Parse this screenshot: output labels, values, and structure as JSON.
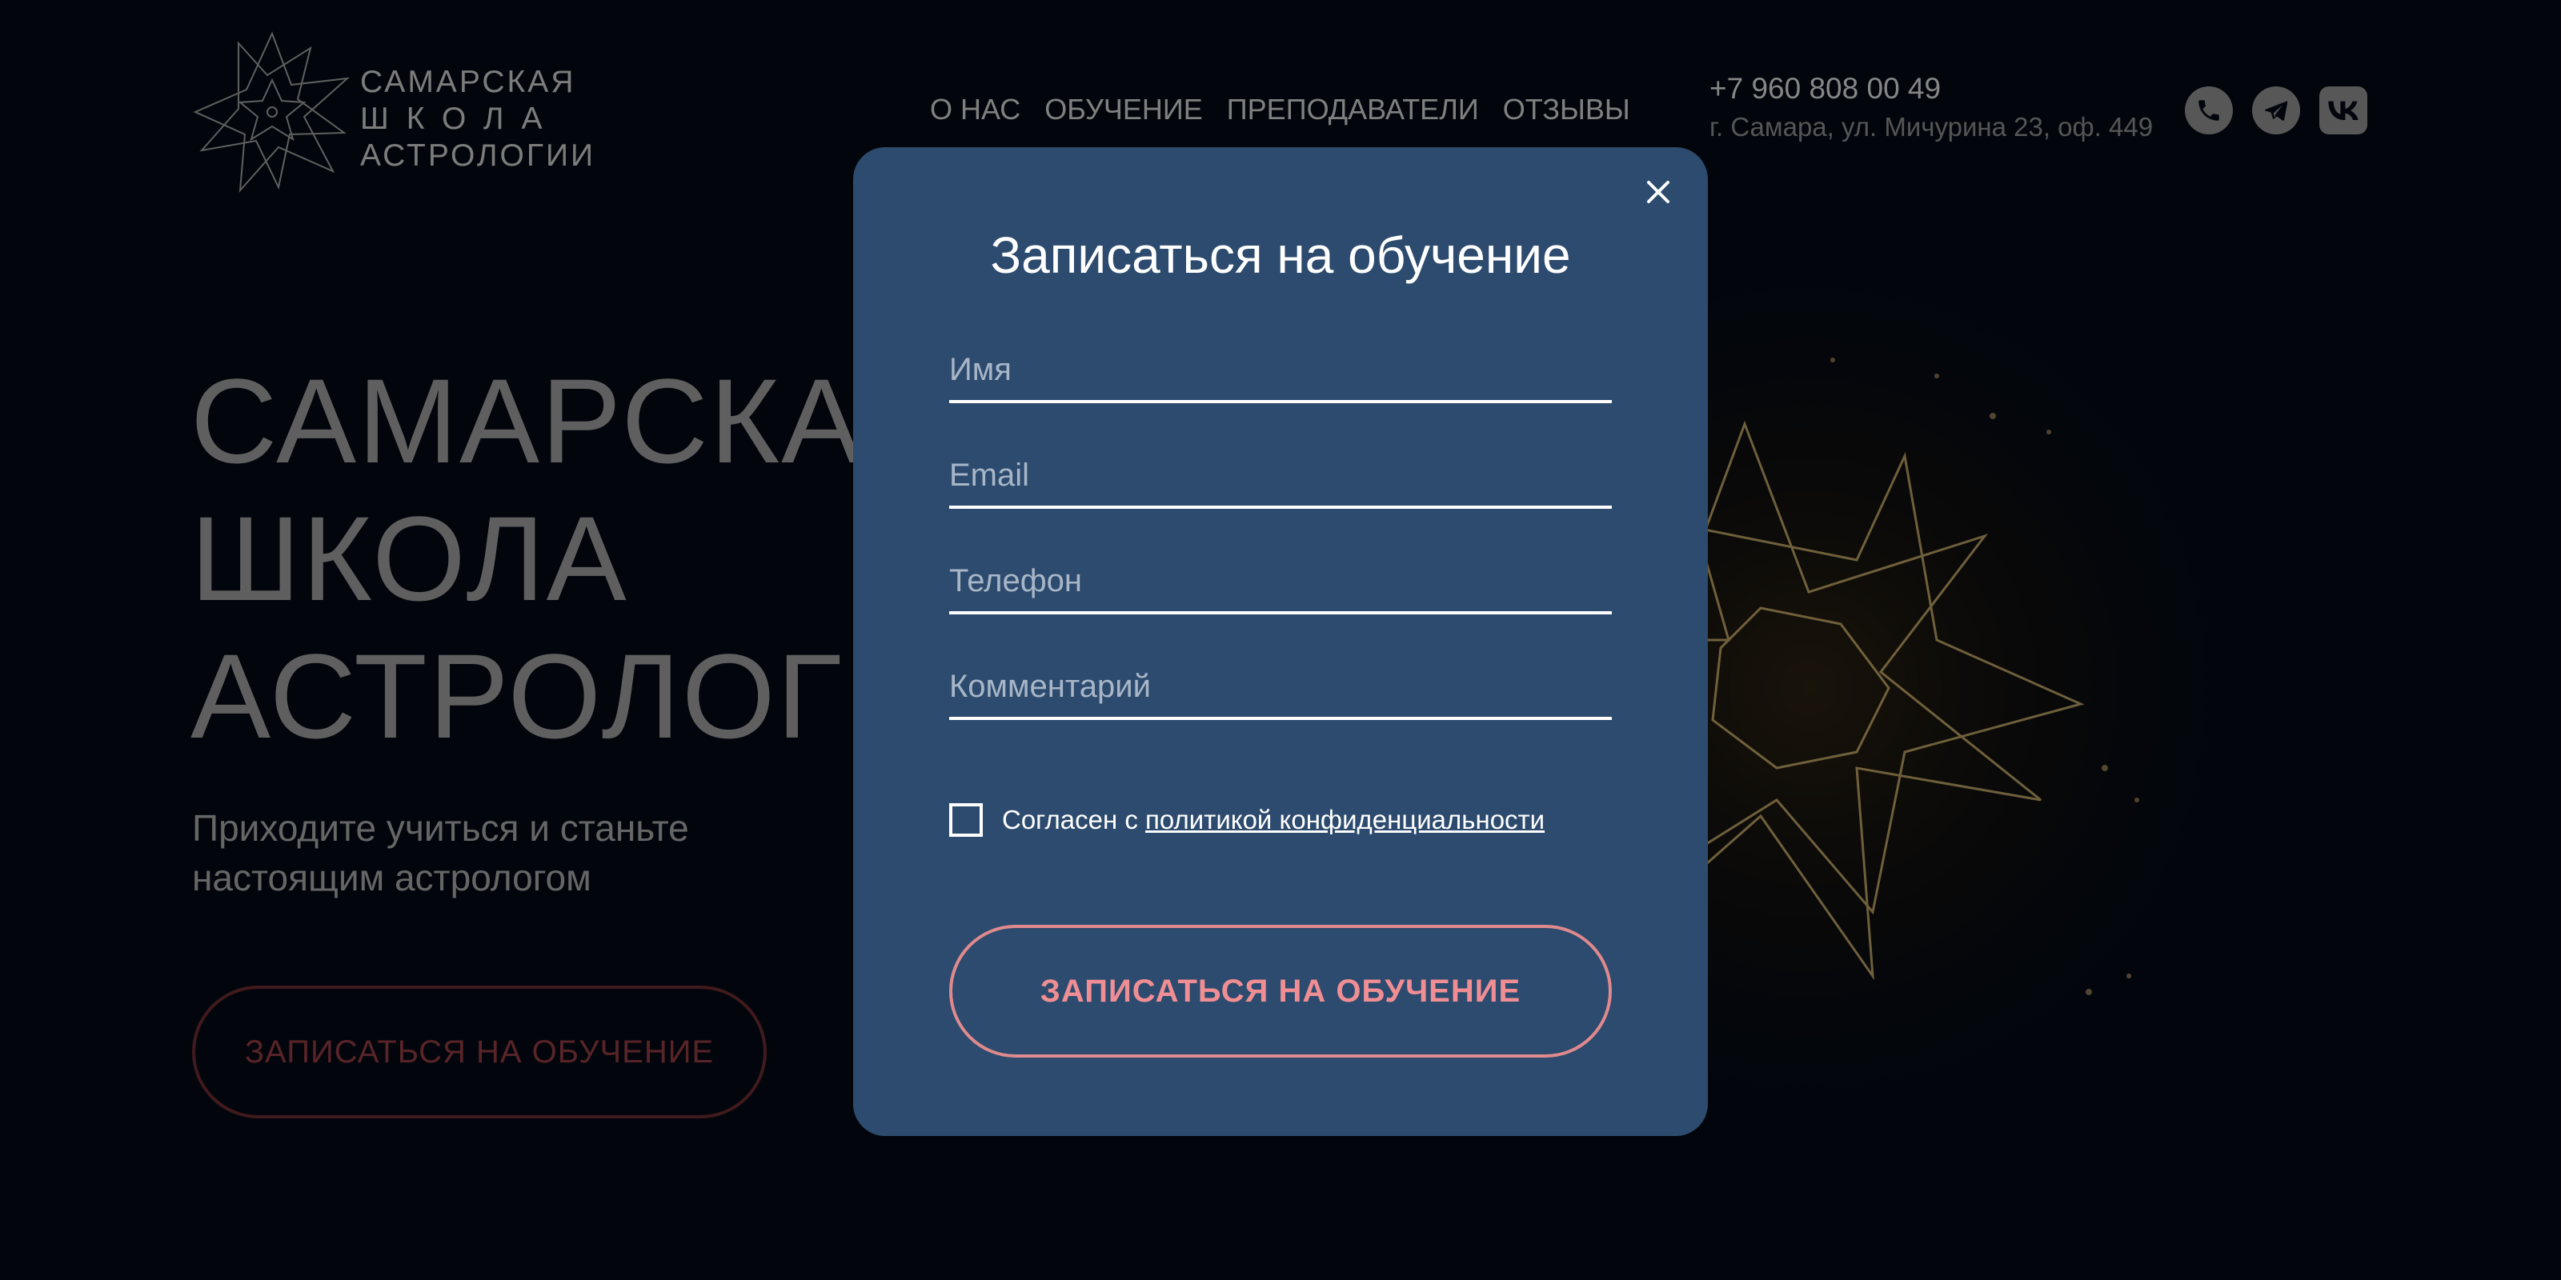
{
  "brand": {
    "logo_lines": [
      "САМАРСКАЯ",
      "ШКОЛА",
      "АСТРОЛОГИИ"
    ]
  },
  "nav": {
    "items": [
      {
        "label": "О НАС"
      },
      {
        "label": "ОБУЧЕНИЕ"
      },
      {
        "label": "ПРЕПОДАВАТЕЛИ"
      },
      {
        "label": "ОТЗЫВЫ"
      }
    ]
  },
  "contacts": {
    "phone": "+7 960 808 00 49",
    "address": "г. Самара, ул. Мичурина 23, оф. 449"
  },
  "socials": {
    "icons": [
      "phone-icon",
      "telegram-icon",
      "vk-icon"
    ]
  },
  "hero": {
    "title_lines": [
      "САМАРСКАЯ",
      "ШКОЛА",
      "АСТРОЛОГИИ"
    ],
    "subtitle": "Приходите учиться и станьте настоящим астрологом",
    "cta_label": "ЗАПИСАТЬСЯ НА ОБУЧЕНИЕ"
  },
  "modal": {
    "title": "Записаться на обучение",
    "fields": {
      "name_placeholder": "Имя",
      "email_placeholder": "Email",
      "phone_placeholder": "Телефон",
      "comment_placeholder": "Комментарий"
    },
    "consent_prefix": "Согласен с ",
    "consent_link": "политикой конфиденциальности",
    "consent_checked": false,
    "submit_label": "ЗАПИСАТЬСЯ НА ОБУЧЕНИЕ"
  },
  "colors": {
    "background": "#040a14",
    "modal": "#2d4b6e",
    "accent": "#f08e94",
    "star_glow": "#e8c87a"
  }
}
